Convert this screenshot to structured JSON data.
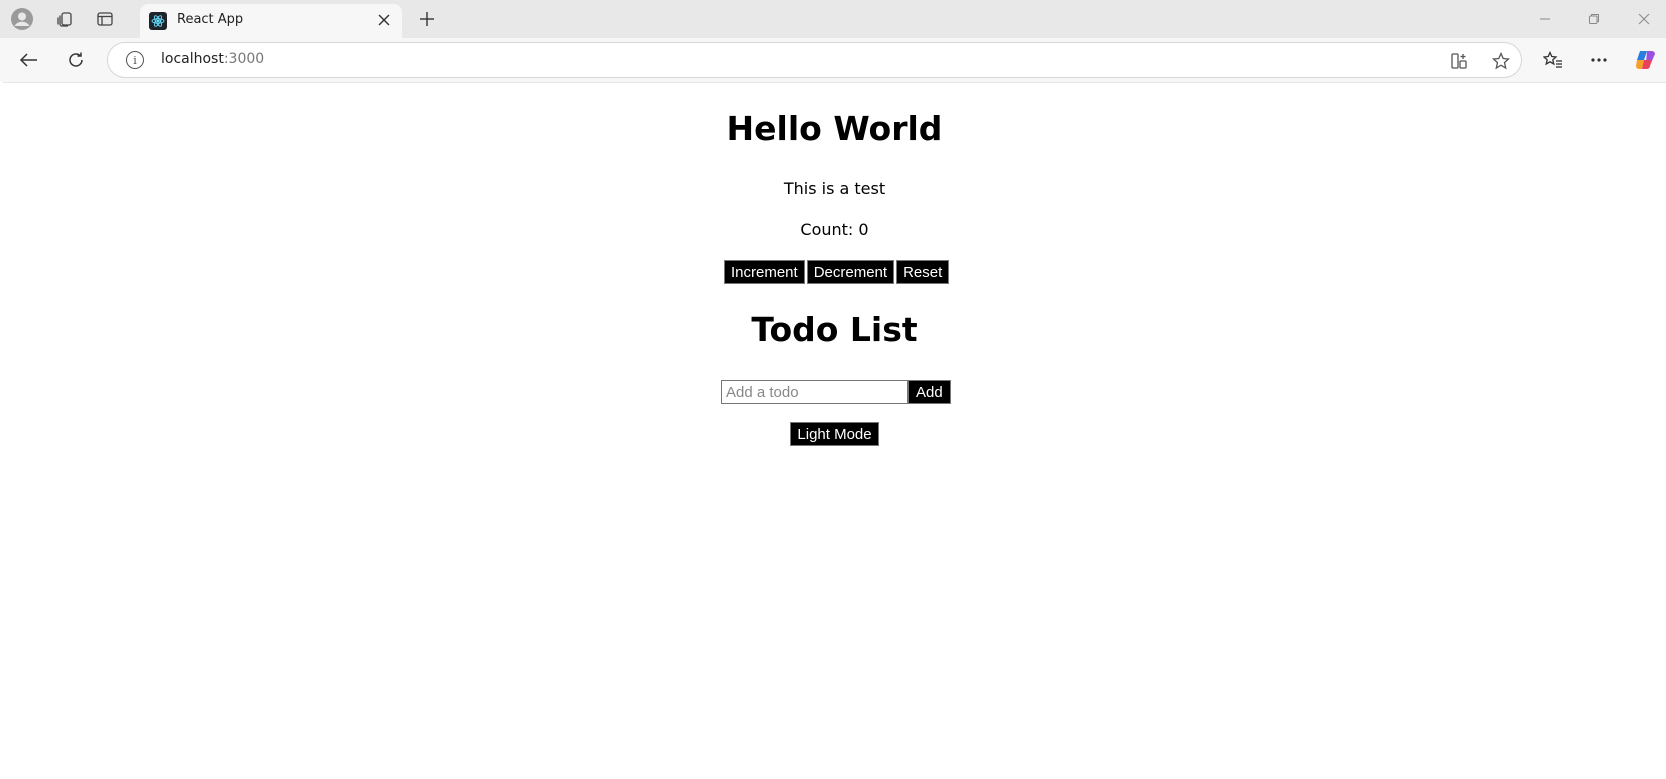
{
  "browser": {
    "tab_title": "React App",
    "address_host": "localhost",
    "address_port": ":3000"
  },
  "app": {
    "heading": "Hello World",
    "subtitle": "This is a test",
    "count_text": "Count: 0",
    "buttons": {
      "increment": "Increment",
      "decrement": "Decrement",
      "reset": "Reset"
    },
    "todo_heading": "Todo List",
    "todo_placeholder": "Add a todo",
    "add_label": "Add",
    "mode_label": "Light Mode"
  }
}
